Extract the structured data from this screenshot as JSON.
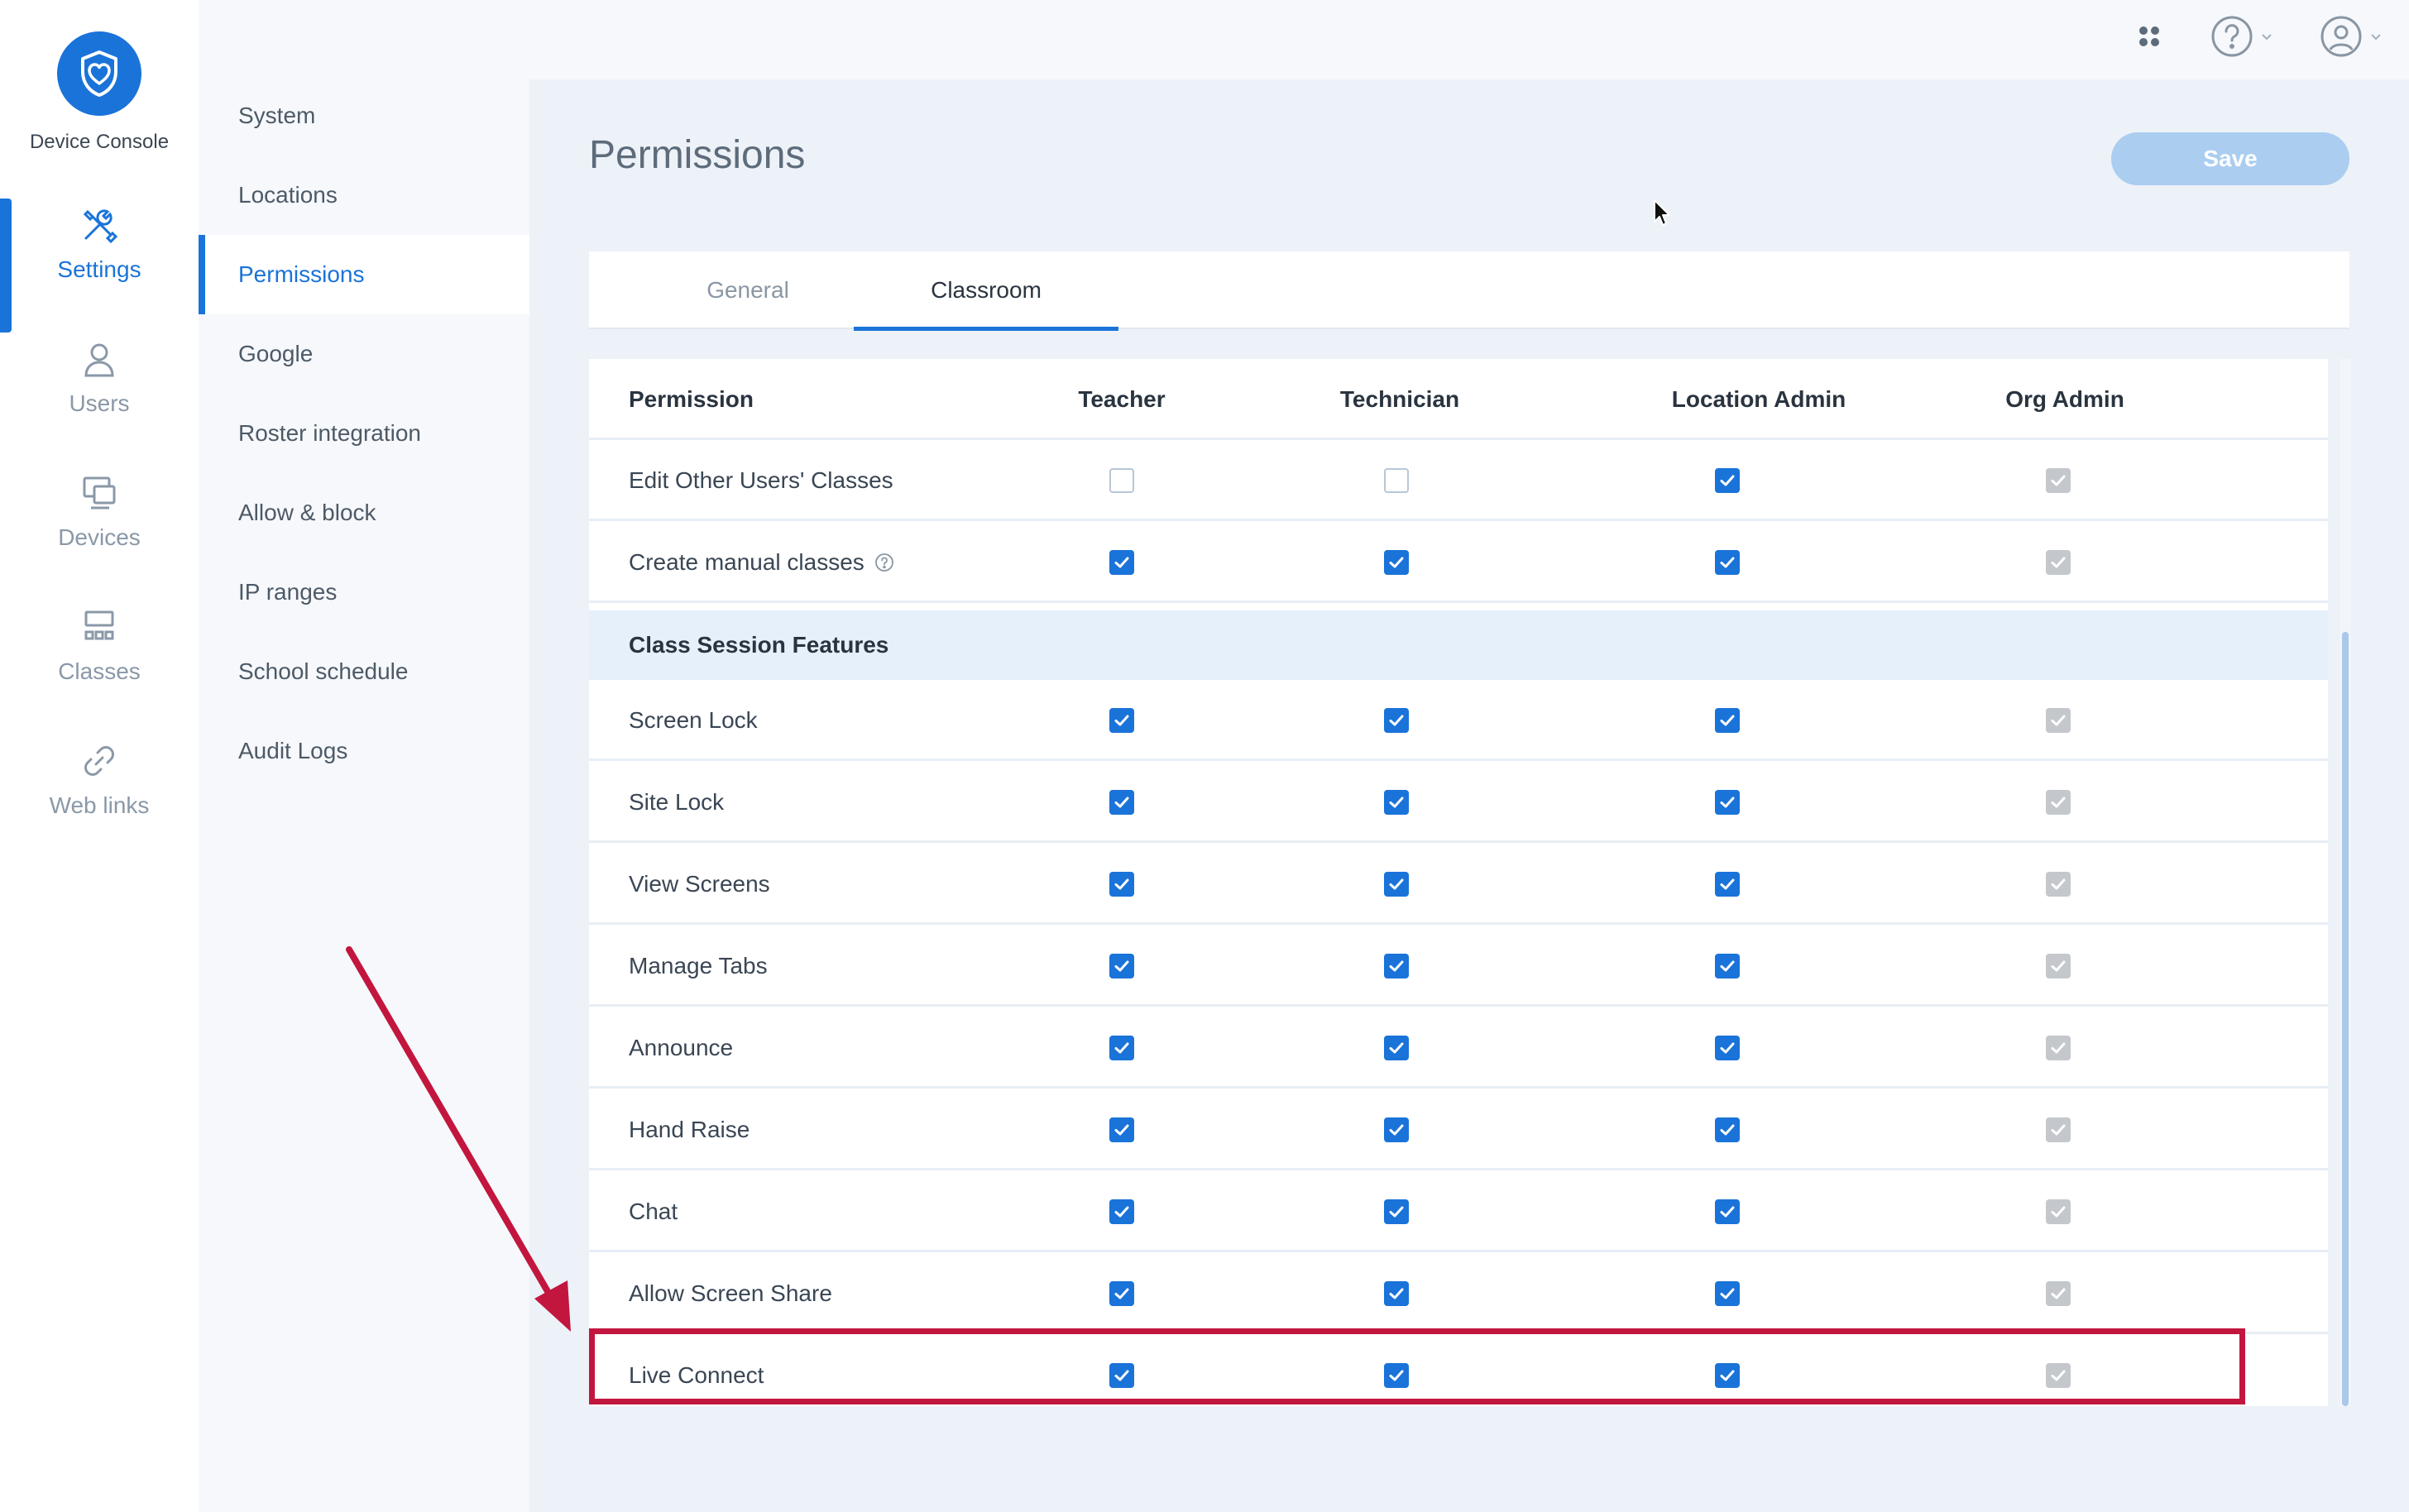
{
  "brand": {
    "name": "Device Console"
  },
  "rail": [
    {
      "label": "Settings",
      "icon": "tools-icon",
      "active": true
    },
    {
      "label": "Users",
      "icon": "user-icon"
    },
    {
      "label": "Devices",
      "icon": "devices-icon"
    },
    {
      "label": "Classes",
      "icon": "classroom-icon"
    },
    {
      "label": "Web links",
      "icon": "link-icon"
    }
  ],
  "submenu": [
    "System",
    "Locations",
    "Permissions",
    "Google",
    "Roster integration",
    "Allow & block",
    "IP ranges",
    "School schedule",
    "Audit Logs"
  ],
  "submenu_active": "Permissions",
  "page": {
    "title": "Permissions",
    "save_label": "Save"
  },
  "tabs": [
    {
      "label": "General",
      "active": false
    },
    {
      "label": "Classroom",
      "active": true
    }
  ],
  "table": {
    "columns": [
      "Permission",
      "Teacher",
      "Technician",
      "Location Admin",
      "Org Admin"
    ],
    "rows": [
      {
        "name": "Edit Other Users' Classes",
        "values": [
          "unchecked",
          "unchecked",
          "checked",
          "checked-disabled"
        ]
      },
      {
        "name": "Create manual classes",
        "info_icon": "help-circle-icon",
        "values": [
          "checked",
          "checked",
          "checked",
          "checked-disabled"
        ]
      },
      {
        "section": "Class Session Features"
      },
      {
        "name": "Screen Lock",
        "values": [
          "checked",
          "checked",
          "checked",
          "checked-disabled"
        ]
      },
      {
        "name": "Site Lock",
        "values": [
          "checked",
          "checked",
          "checked",
          "checked-disabled"
        ]
      },
      {
        "name": "View Screens",
        "values": [
          "checked",
          "checked",
          "checked",
          "checked-disabled"
        ]
      },
      {
        "name": "Manage Tabs",
        "values": [
          "checked",
          "checked",
          "checked",
          "checked-disabled"
        ]
      },
      {
        "name": "Announce",
        "values": [
          "checked",
          "checked",
          "checked",
          "checked-disabled"
        ]
      },
      {
        "name": "Hand Raise",
        "values": [
          "checked",
          "checked",
          "checked",
          "checked-disabled"
        ]
      },
      {
        "name": "Chat",
        "values": [
          "checked",
          "checked",
          "checked",
          "checked-disabled"
        ]
      },
      {
        "name": "Allow Screen Share",
        "values": [
          "checked",
          "checked",
          "checked",
          "checked-disabled"
        ]
      },
      {
        "name": "Live Connect",
        "values": [
          "checked",
          "checked",
          "checked",
          "checked-disabled"
        ],
        "highlighted": true
      }
    ]
  },
  "colors": {
    "accent": "#1a73d9",
    "save_button": "#aacdf0",
    "highlight": "#c2163f",
    "disabled_check": "#c4c8cd"
  },
  "topbar_icons": [
    "apps-icon",
    "help-icon",
    "account-icon"
  ]
}
